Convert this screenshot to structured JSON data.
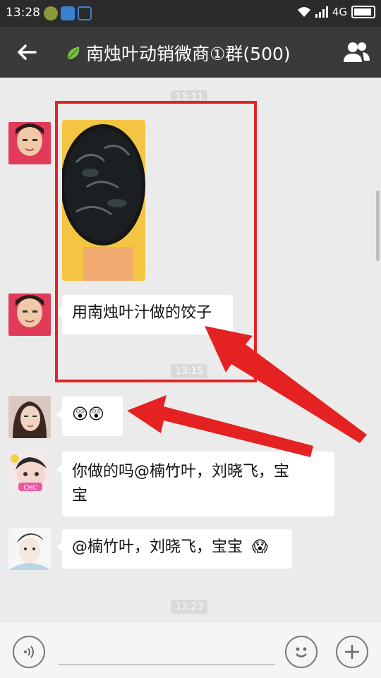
{
  "status_bar": {
    "time": "13:28",
    "network": "4G"
  },
  "header": {
    "title": "南烛叶动销微商①群(500)"
  },
  "timestamps": [
    "13:11",
    "13:15",
    "13:23"
  ],
  "messages": [
    {
      "type": "image",
      "avatar": "avatar-boy"
    },
    {
      "type": "text",
      "avatar": "avatar-boy",
      "text": "用南烛叶汁做的饺子"
    },
    {
      "type": "emoji",
      "avatar": "avatar-girl",
      "emoji": "😲😲"
    },
    {
      "type": "text",
      "avatar": "avatar-cartoon",
      "lines": [
        "你做的吗@楠竹叶，刘晓飞，宝",
        "宝"
      ]
    },
    {
      "type": "text",
      "avatar": "avatar-sketch",
      "text": "@楠竹叶，刘晓飞，宝宝",
      "emoji": "😱"
    }
  ],
  "colors": {
    "highlight": "#e52222",
    "navbar": "#3a3a3a",
    "statusbar": "#2b2b2b",
    "chat_bg": "#ebebeb"
  }
}
